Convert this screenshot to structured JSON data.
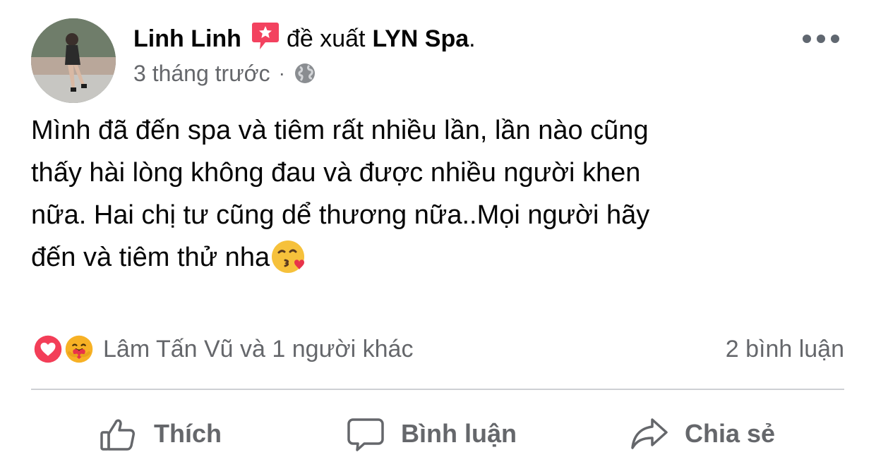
{
  "header": {
    "author": "Linh Linh",
    "recommend_text": "đề xuất",
    "page_name": "LYN Spa",
    "period": ".",
    "timestamp": "3 tháng trước",
    "separator": "·",
    "privacy_icon": "globe-icon",
    "more_icon": "more-horizontal-icon"
  },
  "post": {
    "lines": [
      "Mình đã đến spa và tiêm rất nhiều lần, lần nào cũng",
      "thấy hài lòng không đau và được nhiều người khen",
      "nữa. Hai chị tư cũng dể thương nữa..Mọi người hãy",
      "đến và tiêm thử nha"
    ],
    "trailing_emoji": "face-blowing-kiss-emoji"
  },
  "reactions": {
    "icons": [
      "love-reaction-icon",
      "care-reaction-icon"
    ],
    "names": "Lâm Tấn Vũ và 1 người khác",
    "comments": "2 bình luận"
  },
  "actions": {
    "like": "Thích",
    "comment": "Bình luận",
    "share": "Chia sẻ"
  },
  "colors": {
    "recommend_badge": "#f3425f",
    "love": "#f33e58",
    "care": "#f7b125",
    "secondary_text": "#65676b",
    "divider": "#ced0d4"
  }
}
